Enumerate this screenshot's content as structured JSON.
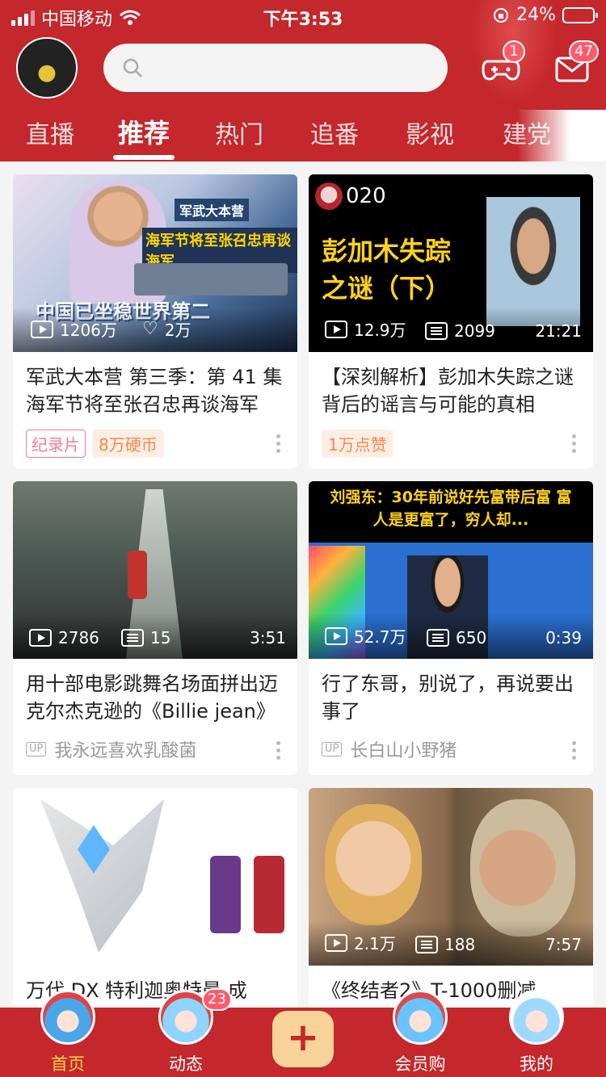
{
  "status_bar": {
    "carrier": "中国移动",
    "time": "下午3:53",
    "battery": "24%"
  },
  "header": {
    "search_placeholder": "",
    "game_badge": "1",
    "mail_badge": "47",
    "tabs": [
      "直播",
      "推荐",
      "热门",
      "追番",
      "影视",
      "建党"
    ],
    "active_tab": "推荐"
  },
  "thumb_text": {
    "c1_banner": "海军节将至张召忠再谈海军",
    "c1_logo": "军武大本营",
    "c1_big": "中国已坐稳世界第二",
    "c2_big": "彭加木失踪之谜（下）",
    "c2_user": "020",
    "c4_big": "刘强东：30年前说好先富带后富 富人是更富了，穷人却..."
  },
  "cards": [
    {
      "title": "军武大本营 第三季：第 41 集 海军节将至张召忠再谈海军",
      "views": "1206万",
      "likes": "2万",
      "tag1": "纪录片",
      "tag2": "8万硬币"
    },
    {
      "title": "【深刻解析】彭加木失踪之谜背后的谣言与可能的真相",
      "views": "12.9万",
      "danmaku": "2099",
      "duration": "21:21",
      "tag2": "1万点赞"
    },
    {
      "title": "用十部电影跳舞名场面拼出迈克尔杰克逊的《Billie jean》",
      "views": "2786",
      "danmaku": "15",
      "duration": "3:51",
      "up_badge": "UP",
      "up": "我永远喜欢乳酸菌"
    },
    {
      "title": "行了东哥，别说了，再说要出事了",
      "views": "52.7万",
      "danmaku": "650",
      "duration": "0:39",
      "up_badge": "UP",
      "up": "长白山小野猪"
    },
    {
      "title": "万代 DX 特利迦奥特曼 成",
      "views": "",
      "danmaku": "",
      "duration": ""
    },
    {
      "title": "《终结者2》T-1000删减",
      "views": "2.1万",
      "danmaku": "188",
      "duration": "7:57"
    }
  ],
  "bottom_nav": {
    "home": "首页",
    "dynamic": "动态",
    "dynamic_badge": "23",
    "plus": "+",
    "vip": "会员购",
    "mine": "我的"
  },
  "colors": {
    "brand_red": "#c4272c",
    "active_nav": "#ffd84a",
    "badge_pink": "#ff5a6b"
  }
}
